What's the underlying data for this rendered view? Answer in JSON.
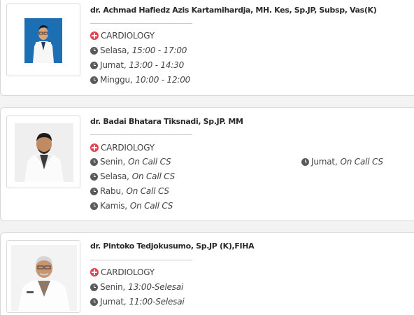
{
  "doctors": [
    {
      "name": "dr. Achmad Hafiedz Azis Kartamihardja, MH. Kes, Sp.JP, Subsp, Vas(K)",
      "specialty": "CARDIOLOGY",
      "schedules": [
        {
          "day": "Selasa,",
          "time": "15:00 - 17:00"
        },
        {
          "day": "Jumat,",
          "time": "13:00 - 14:30"
        },
        {
          "day": "Minggu,",
          "time": "10:00 - 12:00"
        }
      ]
    },
    {
      "name": "dr. Badai Bhatara Tiksnadi, Sp.JP. MM",
      "specialty": "CARDIOLOGY",
      "schedules": [
        {
          "day": "Senin,",
          "time": "On Call CS"
        },
        {
          "day": "Selasa,",
          "time": "On Call CS"
        },
        {
          "day": "Rabu,",
          "time": "On Call CS"
        },
        {
          "day": "Kamis,",
          "time": "On Call CS"
        },
        {
          "day": "Jumat,",
          "time": "On Call CS"
        }
      ]
    },
    {
      "name": "dr. Pintoko Tedjokusumo, Sp.JP (K),FIHA",
      "specialty": "CARDIOLOGY",
      "schedules": [
        {
          "day": "Senin,",
          "time": "13:00-Selesai"
        },
        {
          "day": "Jumat,",
          "time": "11:00-Selesai"
        }
      ]
    }
  ],
  "colors": {
    "accent": "#e0424e",
    "icon": "#5a5a5a",
    "text": "#444444"
  },
  "icons": {
    "specialty": "cross-icon",
    "schedule": "clock-icon"
  }
}
